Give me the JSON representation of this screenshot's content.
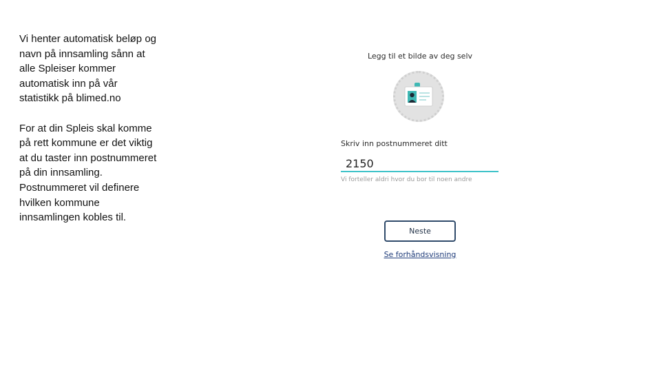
{
  "notes": {
    "paragraph1": "Vi henter automatisk beløp og navn på innsamling sånn at alle Spleiser kommer automatisk inn på vår statistikk på blimed.no",
    "paragraph2": "For at din Spleis skal komme på rett kommune er det viktig at du taster inn postnummeret på din innsamling. Postnummeret vil definere hvilken kommune innsamlingen kobles til."
  },
  "form": {
    "photo_title": "Legg til et bilde av deg selv",
    "photo_icon": "id-card-icon",
    "postal_label": "Skriv inn postnummeret ditt",
    "postal_value": "2150",
    "postal_hint": "Vi forteller aldri hvor du bor til noen andre",
    "next_label": "Neste",
    "preview_label": "Se forhåndsvisning"
  },
  "colors": {
    "input_underline": "#3fc3c9",
    "button_border": "#2f4a6a",
    "link": "#1f3c7a",
    "id_card_accent": "#3fb8b4"
  }
}
